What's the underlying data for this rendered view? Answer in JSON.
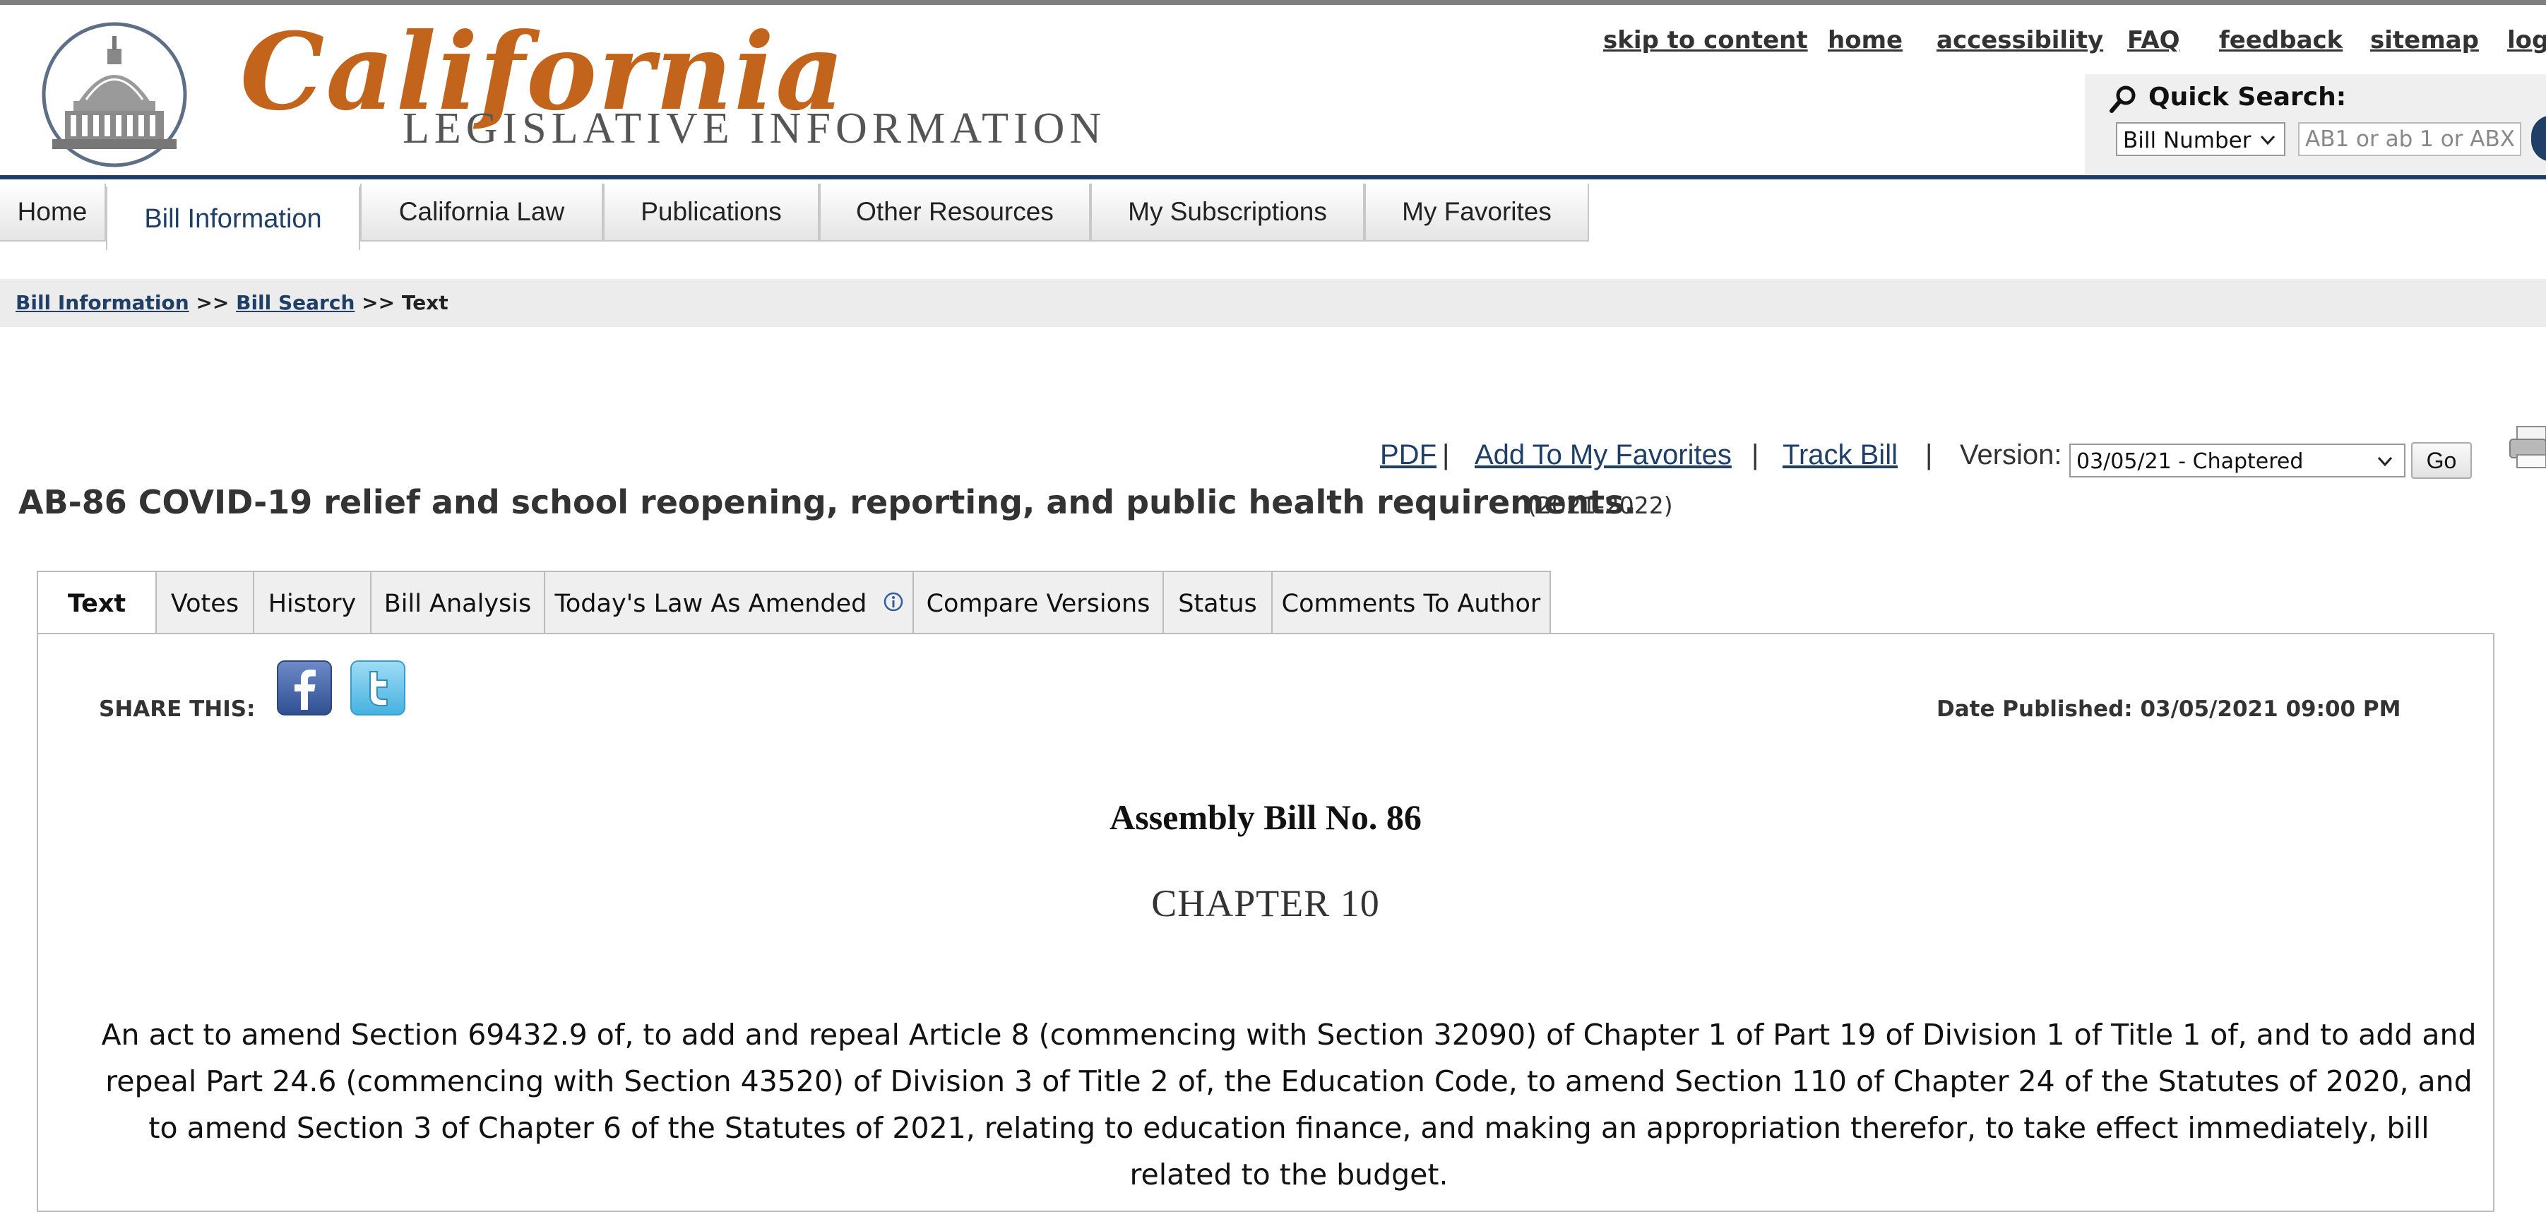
{
  "header": {
    "logo_script": "California",
    "logo_sub": "LEGISLATIVE INFORMATION",
    "utility_links": [
      "skip to content",
      "home",
      "accessibility",
      "FAQ",
      "feedback",
      "sitemap",
      "log"
    ],
    "quick_search": {
      "label": "Quick Search:",
      "select_value": "Bill Number",
      "input_placeholder": "AB1 or ab 1 or ABX"
    }
  },
  "nav": {
    "tabs": [
      "Home",
      "Bill Information",
      "California Law",
      "Publications",
      "Other Resources",
      "My Subscriptions",
      "My Favorites"
    ],
    "active": "Bill Information"
  },
  "breadcrumb": {
    "items": [
      "Bill Information",
      "Bill Search",
      "Text"
    ],
    "separator": ">>"
  },
  "actions": {
    "pdf": "PDF",
    "favorites": "Add To My Favorites",
    "track": "Track Bill",
    "separator": "|",
    "version_label": "Version:",
    "version_value": "03/05/21 - Chaptered",
    "go": "Go"
  },
  "bill": {
    "title": "AB-86 COVID-19 relief and school reopening, reporting, and public health requirements.",
    "session": "(2021-2022)"
  },
  "tabs": {
    "items": [
      "Text",
      "Votes",
      "History",
      "Bill Analysis",
      "Today's Law As Amended",
      "Compare Versions",
      "Status",
      "Comments To Author"
    ],
    "active": "Text"
  },
  "content": {
    "share_label": "SHARE THIS:",
    "date_published": "Date Published: 03/05/2021 09:00 PM",
    "heading": "Assembly Bill No. 86",
    "chapter": "CHAPTER 10",
    "act_text": "An act to amend Section 69432.9 of, to add and repeal Article 8 (commencing with Section 32090) of Chapter 1 of Part 19 of Division 1 of Title 1 of, and to add and repeal Part 24.6 (commencing with Section 43520) of Division 3 of Title 2 of, the Education Code, to amend Section 110 of Chapter 24 of the Statutes of 2020, and to amend Section 3 of Chapter 6 of the Statutes of 2021, relating to education finance, and making an appropriation therefor, to take effect immediately, bill related to the budget."
  },
  "colors": {
    "brand_navy": "#1f3f66",
    "logo_orange": "#c3641c",
    "facebook_blue": "#3b5998",
    "twitter_blue": "#55acee"
  },
  "icons": [
    "capitol-seal-icon",
    "search-icon",
    "chevron-down-icon",
    "print-icon",
    "info-icon",
    "facebook-icon",
    "twitter-icon"
  ]
}
